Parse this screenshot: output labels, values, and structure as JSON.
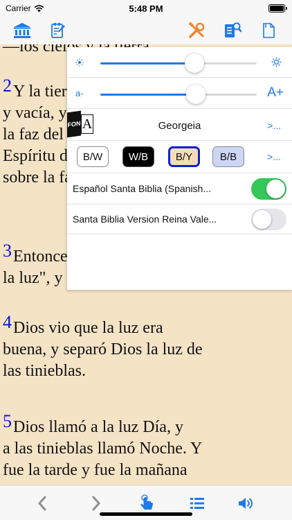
{
  "status_bar": {
    "carrier": "Carrier",
    "time": "5:48 PM"
  },
  "nav_bar": {
    "icons": [
      "bank-icon",
      "edit-note-icon",
      "tools-icon",
      "book-search-icon",
      "document-icon"
    ]
  },
  "reader": {
    "partial_top_line": "—los cielos y la tierra.",
    "verses": [
      {
        "number": "2",
        "lines": [
          "Y la tierra estaba desordenada",
          "y vacía, y las tinieblas sobre",
          "la faz del abismo, y el",
          "Espíritu de Dios se movía",
          "sobre la faz de las aguas."
        ]
      },
      {
        "number": "3",
        "lines": [
          "Entonces dijo Dios: \"Sea",
          "la luz\", y fue la luz."
        ]
      },
      {
        "number": "4",
        "lines": [
          "Dios vio que la luz era",
          "buena, y separó Dios la luz de",
          "las tinieblas."
        ]
      },
      {
        "number": "5",
        "lines": [
          "Dios llamó a la luz Día, y",
          "a las tinieblas llamó Noche. Y",
          "fue la tarde y fue la mañana"
        ]
      }
    ]
  },
  "settings_panel": {
    "brightness": {
      "value": 0.6
    },
    "font_size": {
      "min_label": "a-",
      "max_label": "A+",
      "value": 0.61
    },
    "font": {
      "icon_text": "FON",
      "icon_letter": "A",
      "name": "Georgeia",
      "more": ">..."
    },
    "themes": {
      "options": [
        {
          "label": "B/W",
          "bg": "#ffffff",
          "fg": "#111111",
          "border": "#8a8a8a"
        },
        {
          "label": "W/B",
          "bg": "#000000",
          "fg": "#ffffff",
          "border": "#555555"
        },
        {
          "label": "B/Y",
          "bg": "#f3ddb8",
          "fg": "#111111",
          "border": "#1020d0"
        },
        {
          "label": "B/B",
          "bg": "#cdd6f5",
          "fg": "#111111",
          "border": "#8a8a8a"
        }
      ],
      "more": ">...",
      "selected": "B/Y"
    },
    "bibles": [
      {
        "label": "Español Santa Biblia (Spanish...",
        "enabled": true
      },
      {
        "label": "Santa Biblia Version Reina Vale...",
        "enabled": false
      }
    ]
  },
  "toolbar": {
    "icons": [
      "back-chevron-icon",
      "forward-chevron-icon",
      "tap-hand-icon",
      "list-icon",
      "speaker-icon"
    ]
  },
  "colors": {
    "accent": "#1f7ae8",
    "toggle_on": "#34c759",
    "verse_number": "#0a14d8",
    "page_bg": "#f5e3c6",
    "nav_orange": "#f0852a"
  }
}
